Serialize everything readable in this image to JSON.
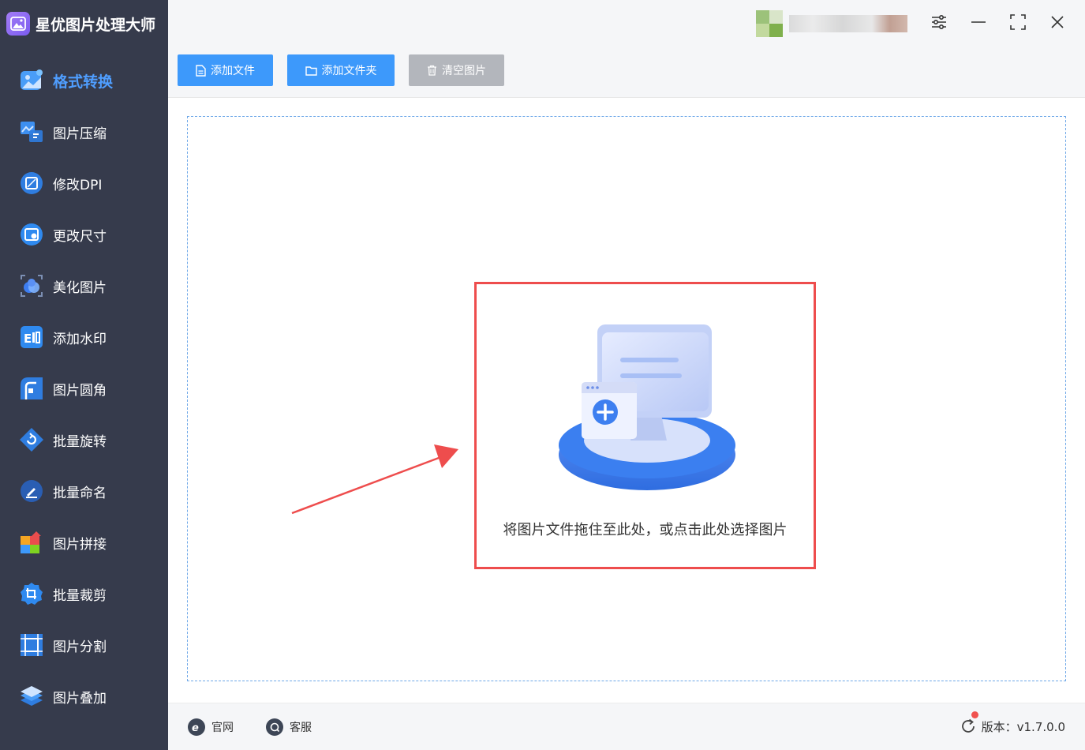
{
  "app": {
    "title": "星优图片处理大师"
  },
  "sidebar": {
    "items": [
      {
        "label": "格式转换",
        "icon": "format-convert-icon",
        "active": true
      },
      {
        "label": "图片压缩",
        "icon": "compress-icon"
      },
      {
        "label": "修改DPI",
        "icon": "dpi-icon"
      },
      {
        "label": "更改尺寸",
        "icon": "resize-icon"
      },
      {
        "label": "美化图片",
        "icon": "beautify-icon"
      },
      {
        "label": "添加水印",
        "icon": "watermark-icon"
      },
      {
        "label": "图片圆角",
        "icon": "round-corner-icon"
      },
      {
        "label": "批量旋转",
        "icon": "rotate-icon"
      },
      {
        "label": "批量命名",
        "icon": "rename-icon"
      },
      {
        "label": "图片拼接",
        "icon": "stitch-icon"
      },
      {
        "label": "批量裁剪",
        "icon": "crop-icon"
      },
      {
        "label": "图片分割",
        "icon": "split-icon"
      },
      {
        "label": "图片叠加",
        "icon": "overlay-icon"
      }
    ]
  },
  "toolbar": {
    "add_file": "添加文件",
    "add_folder": "添加文件夹",
    "clear_images": "清空图片"
  },
  "dropzone": {
    "text": "将图片文件拖住至此处，或点击此处选择图片"
  },
  "footer": {
    "website": "官网",
    "support": "客服",
    "version": "版本：v1.7.0.0"
  },
  "colors": {
    "sidebar_bg": "#363b4c",
    "accent": "#3d99fb",
    "active_text": "#4f9eff",
    "highlight_border": "#ee4d4d",
    "disabled_button": "#b3b6bc"
  }
}
